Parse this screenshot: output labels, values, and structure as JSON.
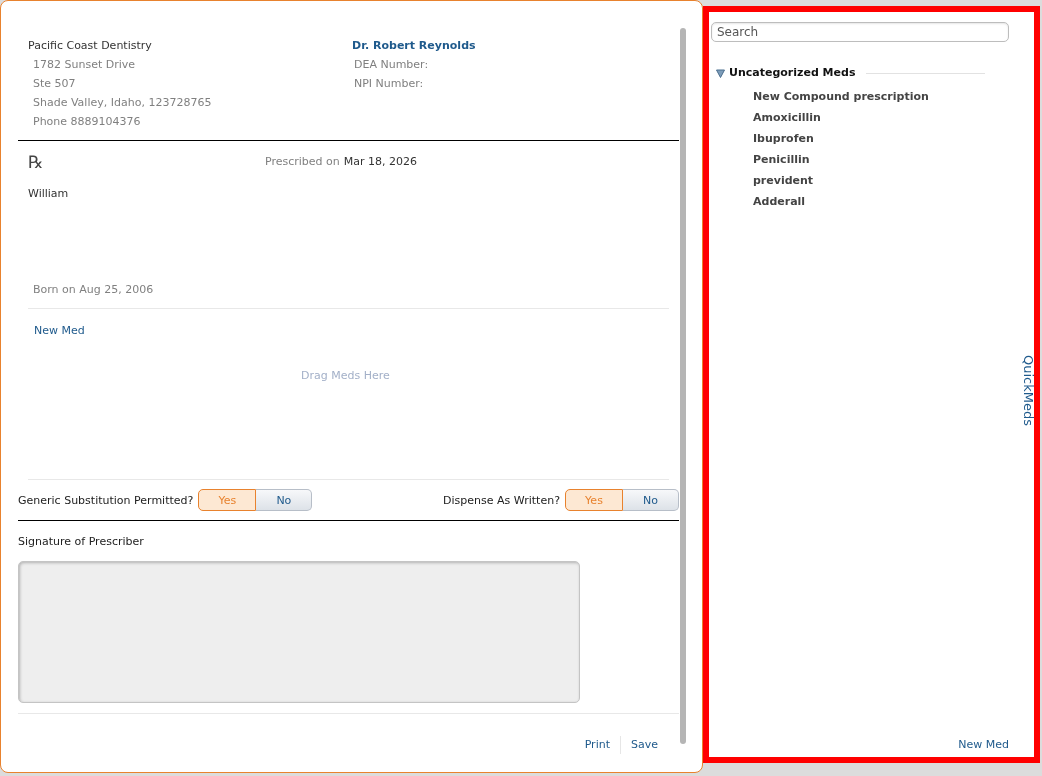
{
  "prescription": {
    "practice": {
      "name": "Pacific Coast Dentistry",
      "address_lines": [
        "1782 Sunset Drive",
        "Ste 507",
        "Shade Valley, Idaho, 123728765",
        "Phone 8889104376"
      ]
    },
    "prescriber": {
      "name": "Dr. Robert Reynolds",
      "fields": [
        "DEA Number:",
        "NPI Number:"
      ]
    },
    "rx_symbol": "℞",
    "prescribed": {
      "label": "Prescribed on",
      "date": "Mar 18, 2026"
    },
    "patient": {
      "name": "William",
      "born": "Born on Aug 25, 2006"
    },
    "meds": {
      "new_med_link": "New Med",
      "drop_hint": "Drag Meds Here"
    },
    "toggles": [
      {
        "label": "Generic Substitution Permitted?",
        "options": [
          {
            "label": "Yes",
            "selected": true
          },
          {
            "label": "No",
            "selected": false
          }
        ]
      },
      {
        "label": "Dispense As Written?",
        "options": [
          {
            "label": "Yes",
            "selected": true
          },
          {
            "label": "No",
            "selected": false
          }
        ]
      }
    ],
    "signature": {
      "label": "Signature of Prescriber"
    },
    "actions": [
      {
        "label": "Print"
      },
      {
        "label": "Save"
      }
    ]
  },
  "quickmeds": {
    "search": {
      "placeholder": "Search"
    },
    "groups": [
      {
        "name": "Uncategorized Meds",
        "expanded": true,
        "items": [
          "New Compound prescription",
          "Amoxicillin",
          "Ibuprofen",
          "Penicillin",
          "prevident",
          "Adderall"
        ]
      }
    ],
    "new_med_link": "New Med",
    "tab_label": "QuickMeds"
  }
}
